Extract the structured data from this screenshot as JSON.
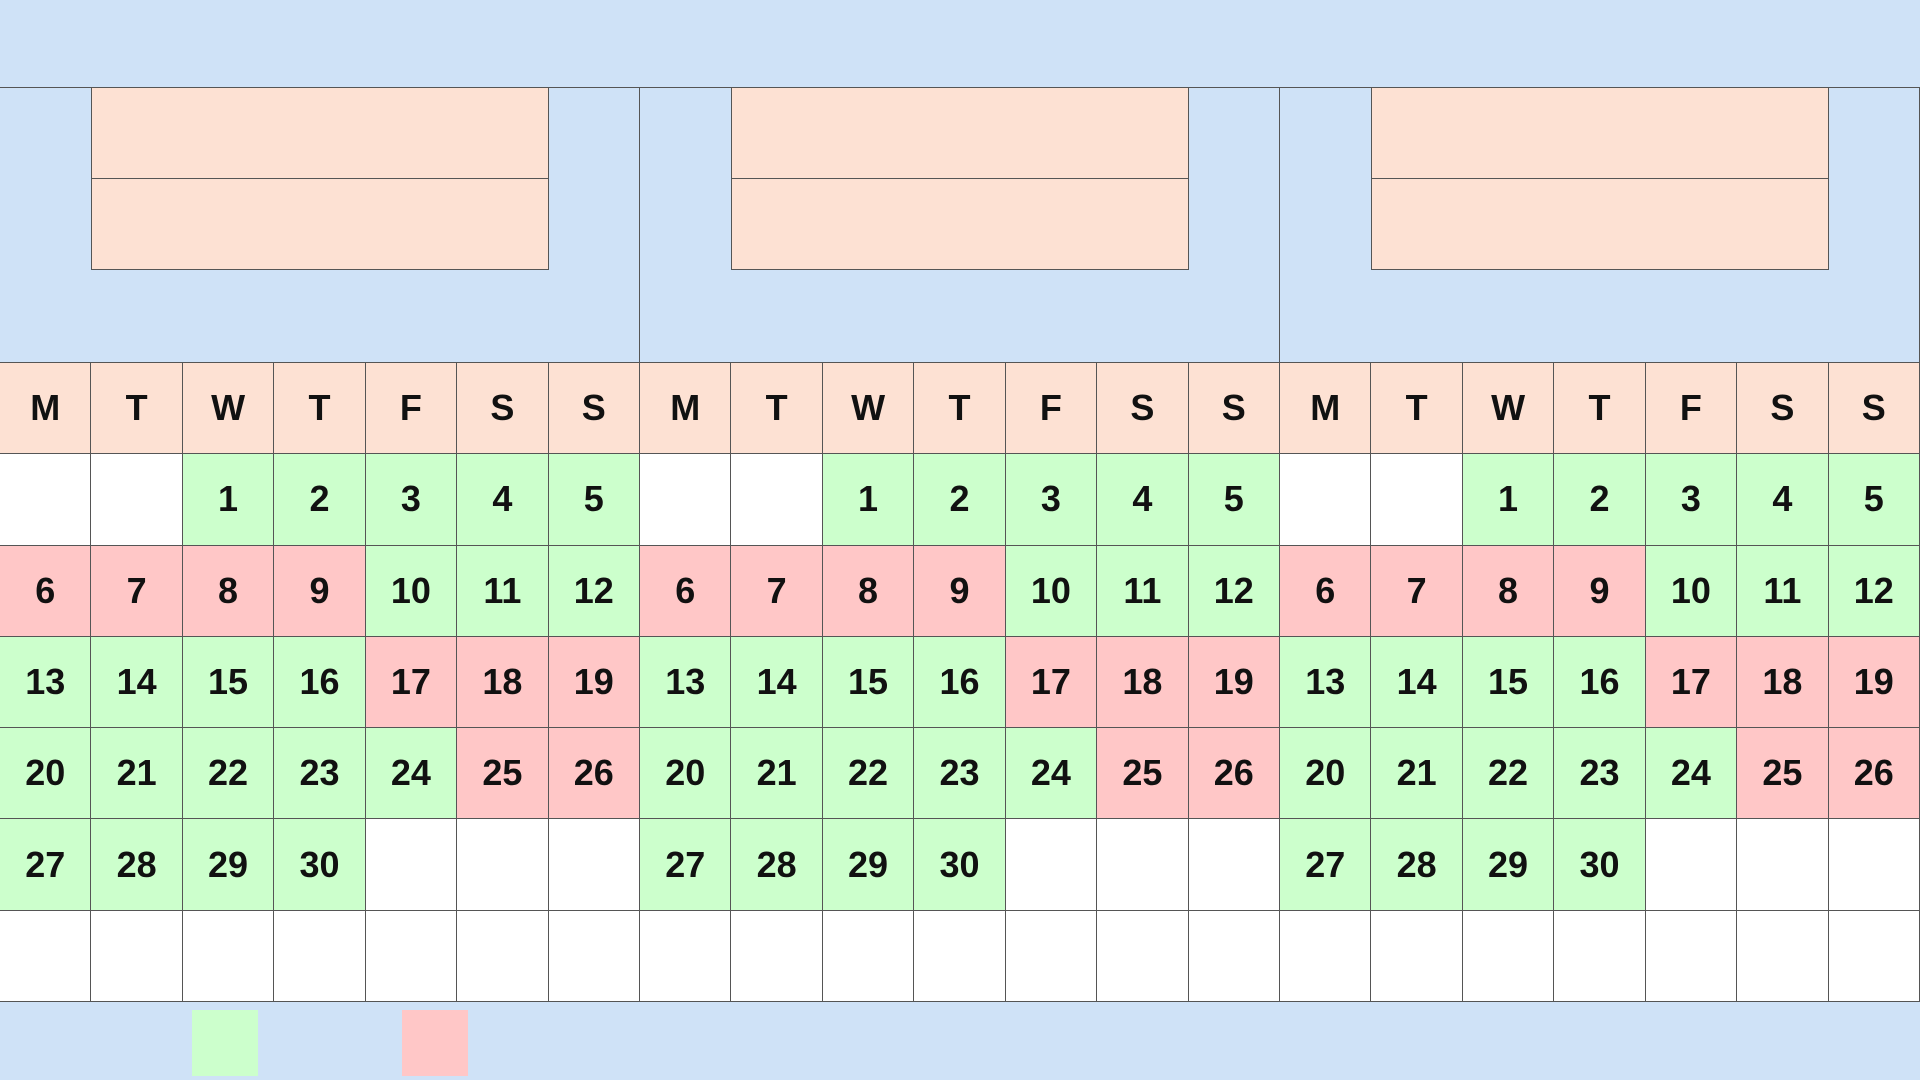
{
  "banner": {
    "title": ""
  },
  "months": [
    {
      "name": "",
      "year": ""
    },
    {
      "name": "",
      "year": ""
    },
    {
      "name": "",
      "year": ""
    }
  ],
  "weekday_headers": [
    "M",
    "T",
    "W",
    "T",
    "F",
    "S",
    "S"
  ],
  "status_colors": {
    "green": "#ccffcc",
    "red": "#ffc7c7",
    "empty": "#ffffff",
    "header": "#fde1d3"
  },
  "calendar": {
    "first_weekday_index": 2,
    "days_in_month": 30,
    "highlighted_red_days": [
      [
        6,
        7,
        8,
        9,
        17,
        18,
        19,
        25,
        26
      ],
      [
        6,
        7,
        8,
        9,
        17,
        18,
        19,
        25,
        26
      ],
      [
        6,
        7,
        8,
        9,
        17,
        18,
        19,
        25,
        26
      ]
    ]
  },
  "legend": [
    {
      "color": "green",
      "label": ""
    },
    {
      "color": "red",
      "label": ""
    }
  ]
}
